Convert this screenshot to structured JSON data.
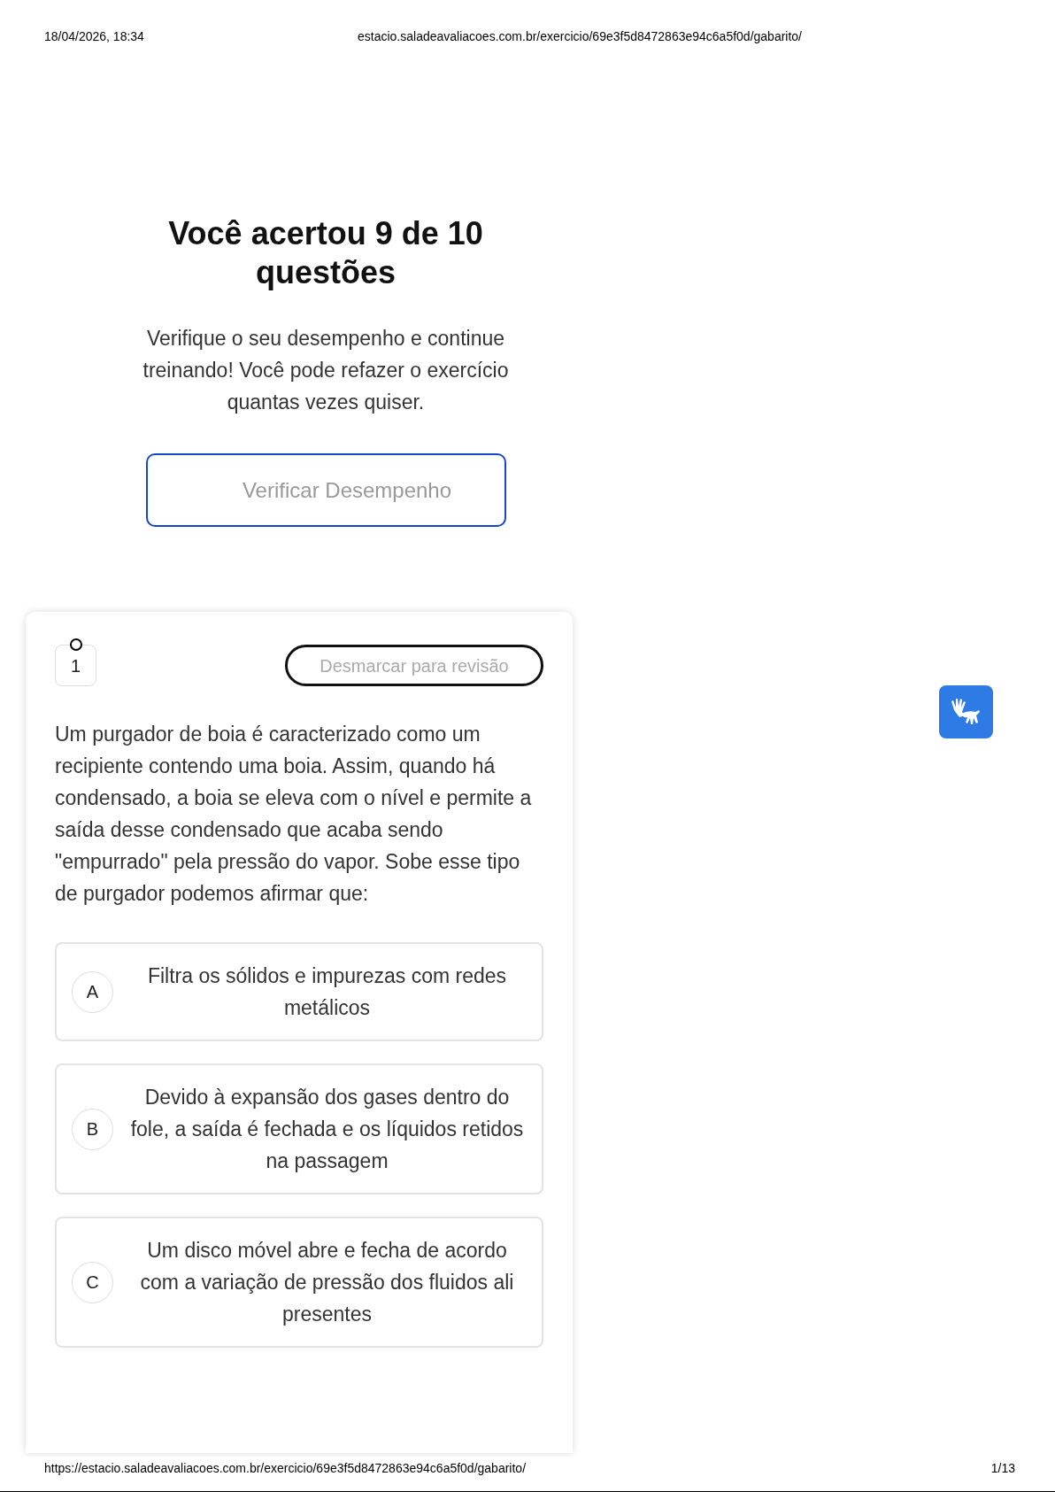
{
  "print_header": {
    "datetime": "18/04/2026, 18:34",
    "url": "estacio.saladeavaliacoes.com.br/exercicio/69e3f5d8472863e94c6a5f0d/gabarito/"
  },
  "result": {
    "title": "Você acertou 9 de 10 questões",
    "message": "Verifique o seu desempenho e continue treinando! Você pode refazer o exercício quantas vezes quiser.",
    "button": "Verificar Desempenho"
  },
  "question": {
    "number": "1",
    "review_button": "Desmarcar para revisão",
    "text": "Um purgador de boia é caracterizado como um recipiente contendo uma boia. Assim, quando há condensado, a boia se eleva com o nível e permite a saída desse condensado que acaba sendo \"empurrado\" pela pressão do vapor. Sobe esse tipo de purgador podemos afirmar que:",
    "options": [
      {
        "letter": "A",
        "text": "Filtra os sólidos e impurezas com redes metálicos"
      },
      {
        "letter": "B",
        "text": "Devido à expansão dos gases dentro do fole, a saída é fechada e os líquidos retidos na passagem"
      },
      {
        "letter": "C",
        "text": "Um disco móvel abre e fecha de acordo com a variação de pressão dos fluidos ali presentes"
      }
    ]
  },
  "print_footer": {
    "url": "https://estacio.saladeavaliacoes.com.br/exercicio/69e3f5d8472863e94c6a5f0d/gabarito/",
    "page": "1/13"
  }
}
